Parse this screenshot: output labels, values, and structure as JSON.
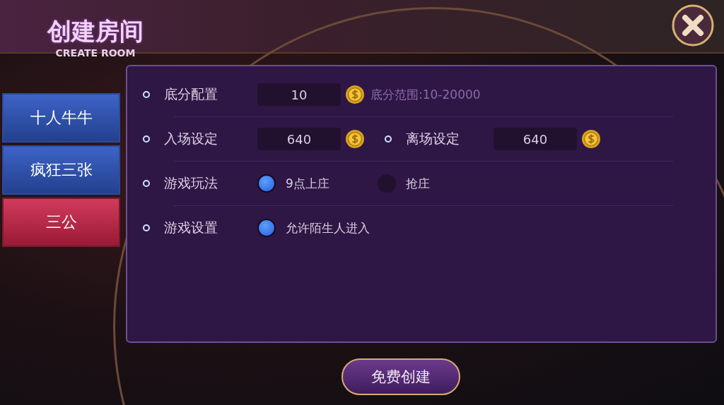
{
  "header": {
    "title": "创建房间",
    "subtitle": "CREATE ROOM"
  },
  "tabs": [
    {
      "label": "十人牛牛",
      "selected": false
    },
    {
      "label": "疯狂三张",
      "selected": false
    },
    {
      "label": "三公",
      "selected": true
    }
  ],
  "settings": [
    {
      "kind": "inputs",
      "fields": [
        {
          "label": "底分配置",
          "value": "10"
        }
      ],
      "hint": "底分范围:10-20000"
    },
    {
      "kind": "inputs",
      "fields": [
        {
          "label": "入场设定",
          "value": "640"
        },
        {
          "label": "离场设定",
          "value": "640"
        }
      ]
    },
    {
      "kind": "radio",
      "label": "游戏玩法",
      "options": [
        {
          "label": "9点上庄",
          "selected": true
        },
        {
          "label": "抢庄",
          "selected": false
        }
      ]
    },
    {
      "kind": "checkbox",
      "label": "游戏设置",
      "options": [
        {
          "label": "允许陌生人进入",
          "checked": true
        }
      ]
    }
  ],
  "create_button": "免费创建"
}
